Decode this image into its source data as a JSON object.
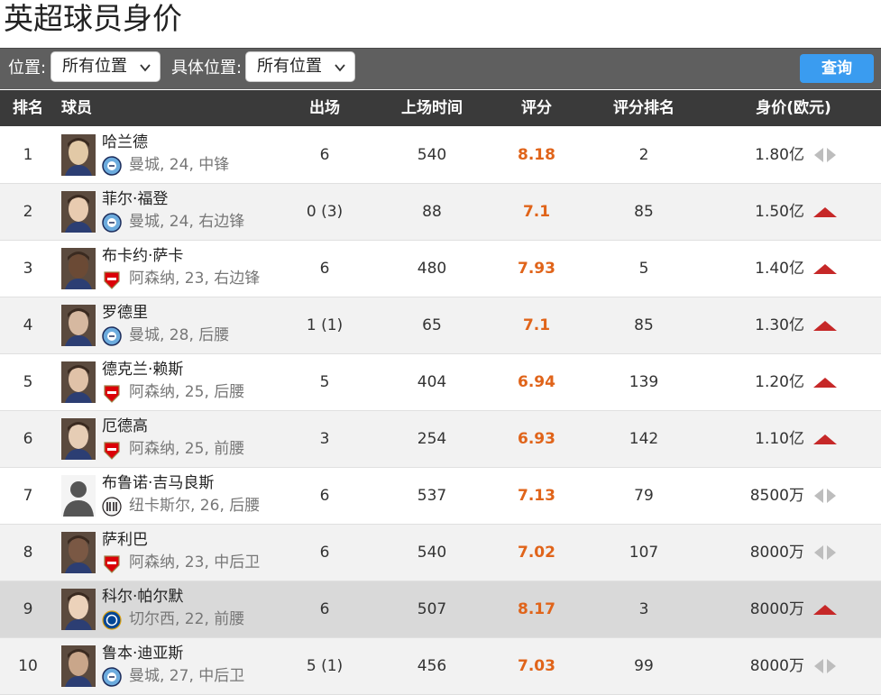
{
  "page": {
    "title": "英超球员身价"
  },
  "filters": {
    "position_label": "位置:",
    "position_value": "所有位置",
    "detail_label": "具体位置:",
    "detail_value": "所有位置",
    "query_label": "查询",
    "colors": {
      "bar": "#5f5f5f",
      "query": "#3a9cf0"
    }
  },
  "table": {
    "headers": {
      "rank": "排名",
      "player": "球员",
      "apps": "出场",
      "minutes": "上场时间",
      "rating": "评分",
      "rating_rank": "评分排名",
      "value": "身价(欧元)"
    },
    "colors": {
      "rating": "#e0641a",
      "up": "#c62828",
      "flat": "#bdbdbd"
    },
    "rows": [
      {
        "rank": "1",
        "name": "哈兰德",
        "info": "曼城, 24, 中锋",
        "club": "man-city",
        "apps": "6",
        "minutes": "540",
        "rating": "8.18",
        "rating_rank": "2",
        "value": "1.80亿",
        "trend": "flat"
      },
      {
        "rank": "2",
        "name": "菲尔·福登",
        "info": "曼城, 24, 右边锋",
        "club": "man-city",
        "apps": "0 (3)",
        "minutes": "88",
        "rating": "7.1",
        "rating_rank": "85",
        "value": "1.50亿",
        "trend": "up"
      },
      {
        "rank": "3",
        "name": "布卡约·萨卡",
        "info": "阿森纳, 23, 右边锋",
        "club": "arsenal",
        "apps": "6",
        "minutes": "480",
        "rating": "7.93",
        "rating_rank": "5",
        "value": "1.40亿",
        "trend": "up"
      },
      {
        "rank": "4",
        "name": "罗德里",
        "info": "曼城, 28, 后腰",
        "club": "man-city",
        "apps": "1 (1)",
        "minutes": "65",
        "rating": "7.1",
        "rating_rank": "85",
        "value": "1.30亿",
        "trend": "up"
      },
      {
        "rank": "5",
        "name": "德克兰·赖斯",
        "info": "阿森纳, 25, 后腰",
        "club": "arsenal",
        "apps": "5",
        "minutes": "404",
        "rating": "6.94",
        "rating_rank": "139",
        "value": "1.20亿",
        "trend": "up"
      },
      {
        "rank": "6",
        "name": "厄德高",
        "info": "阿森纳, 25, 前腰",
        "club": "arsenal",
        "apps": "3",
        "minutes": "254",
        "rating": "6.93",
        "rating_rank": "142",
        "value": "1.10亿",
        "trend": "up"
      },
      {
        "rank": "7",
        "name": "布鲁诺·吉马良斯",
        "info": "纽卡斯尔, 26, 后腰",
        "club": "newcastle",
        "apps": "6",
        "minutes": "537",
        "rating": "7.13",
        "rating_rank": "79",
        "value": "8500万",
        "trend": "flat"
      },
      {
        "rank": "8",
        "name": "萨利巴",
        "info": "阿森纳, 23, 中后卫",
        "club": "arsenal",
        "apps": "6",
        "minutes": "540",
        "rating": "7.02",
        "rating_rank": "107",
        "value": "8000万",
        "trend": "flat"
      },
      {
        "rank": "9",
        "name": "科尔·帕尔默",
        "info": "切尔西, 22, 前腰",
        "club": "chelsea",
        "apps": "6",
        "minutes": "507",
        "rating": "8.17",
        "rating_rank": "3",
        "value": "8000万",
        "trend": "up"
      },
      {
        "rank": "10",
        "name": "鲁本·迪亚斯",
        "info": "曼城, 27, 中后卫",
        "club": "man-city",
        "apps": "5 (1)",
        "minutes": "456",
        "rating": "7.03",
        "rating_rank": "99",
        "value": "8000万",
        "trend": "flat"
      }
    ]
  }
}
